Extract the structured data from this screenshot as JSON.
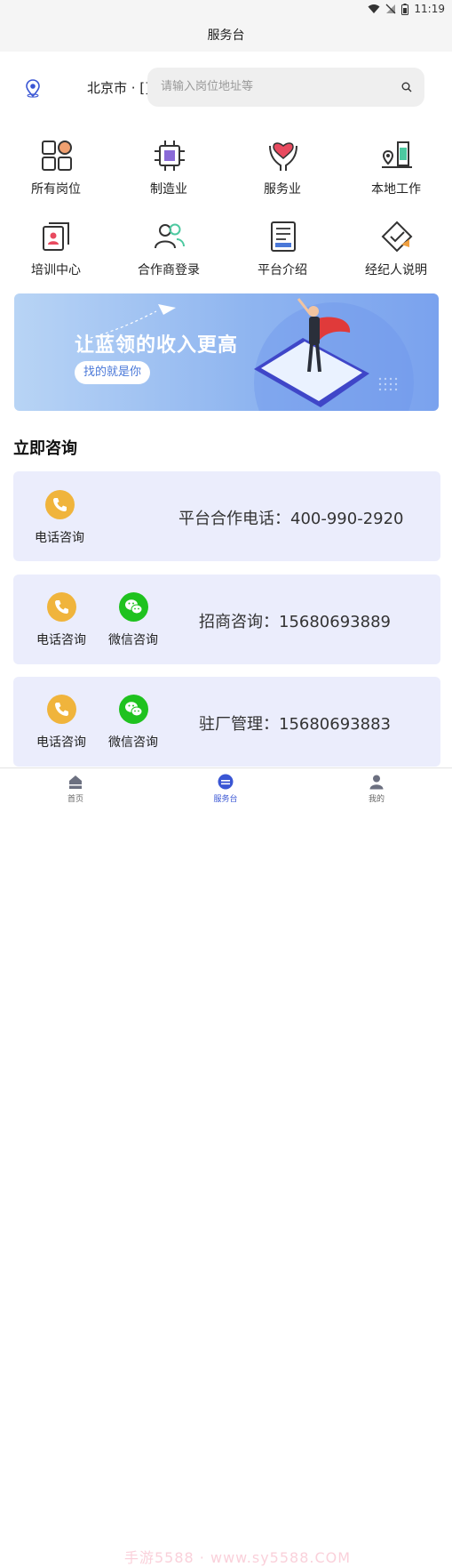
{
  "status_bar": {
    "time": "11:19"
  },
  "header": {
    "title": "服务台"
  },
  "location": {
    "city": "北京市 · []"
  },
  "search": {
    "placeholder": "请输入岗位地址等"
  },
  "categories": [
    {
      "label": "所有岗位",
      "icon": "grid-icon"
    },
    {
      "label": "制造业",
      "icon": "chip-icon"
    },
    {
      "label": "服务业",
      "icon": "heart-hands-icon"
    },
    {
      "label": "本地工作",
      "icon": "local-building-icon"
    },
    {
      "label": "培训中心",
      "icon": "id-card-icon"
    },
    {
      "label": "合作商登录",
      "icon": "users-icon"
    },
    {
      "label": "平台介绍",
      "icon": "document-icon"
    },
    {
      "label": "经纪人说明",
      "icon": "diamond-check-icon"
    }
  ],
  "banner": {
    "title": "让蓝领的收入更高",
    "button": "找的就是你"
  },
  "consult": {
    "title": "立即咨询",
    "cards": [
      {
        "text": "平台合作电话：400-990-2920",
        "phone_label": "电话咨询"
      },
      {
        "text": "招商咨询：15680693889",
        "phone_label": "电话咨询",
        "wechat_label": "微信咨询"
      },
      {
        "text": "驻厂管理：15680693883",
        "phone_label": "电话咨询",
        "wechat_label": "微信咨询"
      }
    ]
  },
  "tabs": [
    {
      "label": "首页",
      "icon": "home-icon"
    },
    {
      "label": "服务台",
      "icon": "service-desk-icon",
      "active": true
    },
    {
      "label": "我的",
      "icon": "profile-icon"
    }
  ],
  "watermark": "手游5588 · www.sy5588.COM",
  "colors": {
    "accent": "#3a56d4",
    "phone": "#f0b43c",
    "wechat": "#1fc21f",
    "card_bg": "#ebedfc"
  }
}
